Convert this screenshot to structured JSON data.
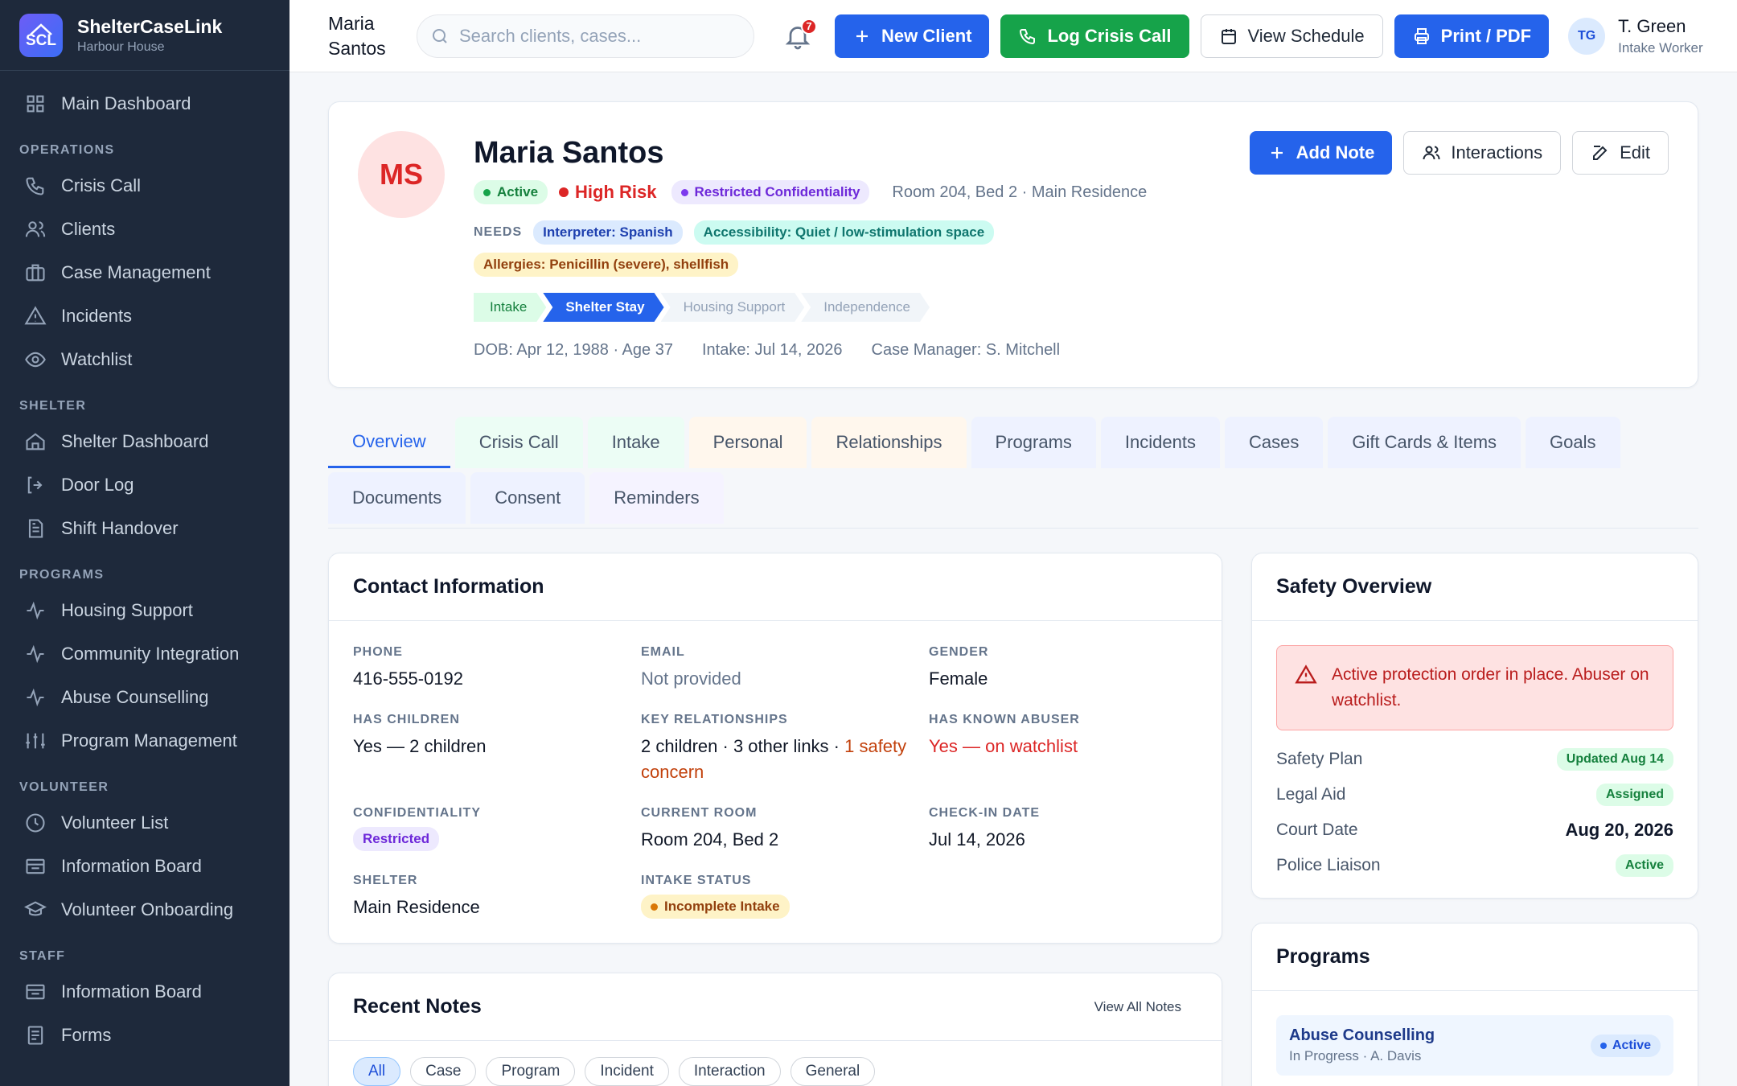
{
  "brand": {
    "logo_text": "SCL",
    "name": "ShelterCaseLink",
    "subtitle": "Harbour House"
  },
  "sidebar": {
    "top": [
      {
        "label": "Main Dashboard",
        "icon": "grid-icon"
      }
    ],
    "sections": [
      {
        "title": "OPERATIONS",
        "items": [
          {
            "label": "Crisis Call",
            "icon": "phone-icon"
          },
          {
            "label": "Clients",
            "icon": "users-icon"
          },
          {
            "label": "Case Management",
            "icon": "briefcase-icon"
          },
          {
            "label": "Incidents",
            "icon": "warning-icon"
          },
          {
            "label": "Watchlist",
            "icon": "eye-icon"
          }
        ]
      },
      {
        "title": "SHELTER",
        "items": [
          {
            "label": "Shelter Dashboard",
            "icon": "home-icon"
          },
          {
            "label": "Door Log",
            "icon": "door-icon"
          },
          {
            "label": "Shift Handover",
            "icon": "document-icon"
          }
        ]
      },
      {
        "title": "PROGRAMS",
        "items": [
          {
            "label": "Housing Support",
            "icon": "activity-icon"
          },
          {
            "label": "Community Integration",
            "icon": "activity-icon"
          },
          {
            "label": "Abuse Counselling",
            "icon": "activity-icon"
          },
          {
            "label": "Program Management",
            "icon": "sliders-icon"
          }
        ]
      },
      {
        "title": "VOLUNTEER",
        "items": [
          {
            "label": "Volunteer List",
            "icon": "clock-icon"
          },
          {
            "label": "Information Board",
            "icon": "board-icon"
          },
          {
            "label": "Volunteer Onboarding",
            "icon": "cap-icon"
          }
        ]
      },
      {
        "title": "STAFF",
        "items": [
          {
            "label": "Information Board",
            "icon": "board-icon"
          },
          {
            "label": "Forms",
            "icon": "form-icon"
          }
        ]
      }
    ]
  },
  "topbar": {
    "client_first": "Maria",
    "client_last": "Santos",
    "search_placeholder": "Search clients, cases...",
    "notification_count": "7",
    "new_client": "New Client",
    "log_crisis_call": "Log Crisis Call",
    "view_schedule": "View Schedule",
    "print_pdf": "Print / PDF",
    "user_initials": "TG",
    "user_name": "T. Green",
    "user_role": "Intake Worker"
  },
  "profile": {
    "initials": "MS",
    "name": "Maria Santos",
    "status": "Active",
    "risk": "High Risk",
    "confidentiality": "Restricted Confidentiality",
    "location": "Room 204, Bed 2 · Main Residence",
    "needs_label": "NEEDS",
    "needs": [
      "Interpreter: Spanish",
      "Accessibility: Quiet / low-stimulation space",
      "Allergies: Penicillin (severe), shellfish"
    ],
    "stages": [
      "Intake",
      "Shelter Stay",
      "Housing Support",
      "Independence"
    ],
    "dob": "DOB: Apr 12, 1988 · Age 37",
    "intake": "Intake: Jul 14, 2026",
    "case_manager": "Case Manager: S. Mitchell",
    "add_note": "Add Note",
    "interactions": "Interactions",
    "edit": "Edit"
  },
  "tabs": [
    {
      "label": "Overview",
      "bg": ""
    },
    {
      "label": "Crisis Call",
      "bg": "#ecfdf5"
    },
    {
      "label": "Intake",
      "bg": "#ecfdf5"
    },
    {
      "label": "Personal",
      "bg": "#fff7ed"
    },
    {
      "label": "Relationships",
      "bg": "#fff7ed"
    },
    {
      "label": "Programs",
      "bg": "#eef2ff"
    },
    {
      "label": "Incidents",
      "bg": "#eef2ff"
    },
    {
      "label": "Cases",
      "bg": "#eef2ff"
    },
    {
      "label": "Gift Cards & Items",
      "bg": "#eef2ff"
    },
    {
      "label": "Goals",
      "bg": "#eef2ff"
    },
    {
      "label": "Documents",
      "bg": "#eef2ff"
    },
    {
      "label": "Consent",
      "bg": "#eef2ff"
    },
    {
      "label": "Reminders",
      "bg": "#f5f3ff"
    }
  ],
  "contact": {
    "title": "Contact Information",
    "phone_label": "PHONE",
    "phone": "416-555-0192",
    "email_label": "EMAIL",
    "email": "Not provided",
    "gender_label": "GENDER",
    "gender": "Female",
    "children_label": "HAS CHILDREN",
    "children": "Yes — 2 children",
    "relationships_label": "KEY RELATIONSHIPS",
    "relationships": "2 children · 3 other links · ",
    "relationships_concern": "1 safety concern",
    "abuser_label": "HAS KNOWN ABUSER",
    "abuser": "Yes — on watchlist",
    "confidentiality_label": "CONFIDENTIALITY",
    "confidentiality": "Restricted",
    "room_label": "CURRENT ROOM",
    "room": "Room 204, Bed 2",
    "checkin_label": "CHECK-IN DATE",
    "checkin": "Jul 14, 2026",
    "shelter_label": "SHELTER",
    "shelter": "Main Residence",
    "intake_status_label": "INTAKE STATUS",
    "intake_status": "Incomplete Intake"
  },
  "notes": {
    "title": "Recent Notes",
    "view_all": "View All Notes",
    "filters": [
      "All",
      "Case",
      "Program",
      "Incident",
      "Interaction",
      "General"
    ]
  },
  "safety": {
    "title": "Safety Overview",
    "alert": "Active protection order in place. Abuser on watchlist.",
    "rows": [
      {
        "label": "Safety Plan",
        "value": "Updated Aug 14",
        "type": "pill"
      },
      {
        "label": "Legal Aid",
        "value": "Assigned",
        "type": "pill"
      },
      {
        "label": "Court Date",
        "value": "Aug 20, 2026",
        "type": "text"
      },
      {
        "label": "Police Liaison",
        "value": "Active",
        "type": "pill"
      }
    ]
  },
  "programs": {
    "title": "Programs",
    "item_name": "Abuse Counselling",
    "item_sub": "In Progress · A. Davis",
    "item_status": "Active"
  }
}
